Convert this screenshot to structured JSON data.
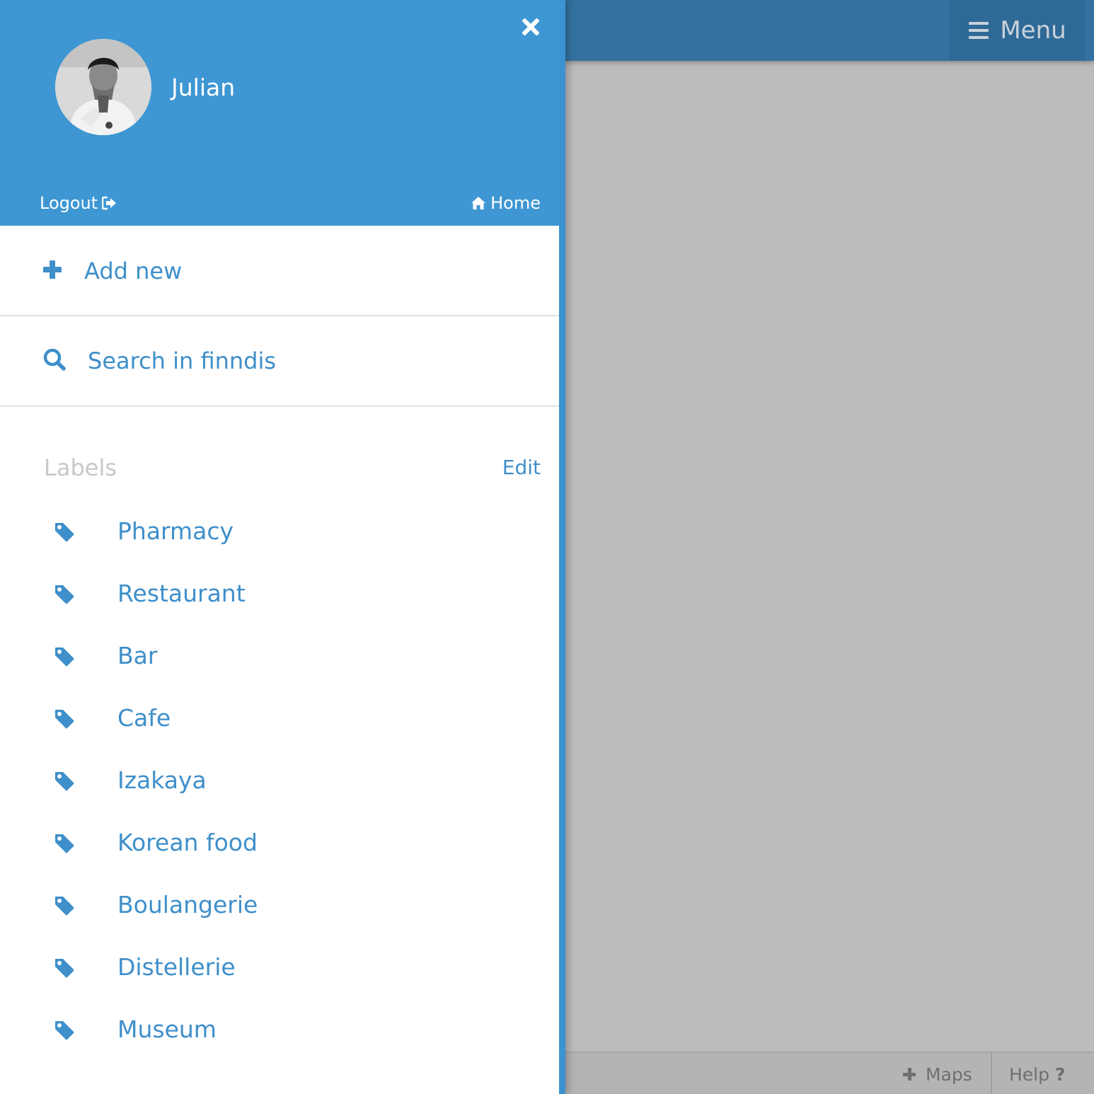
{
  "topbar": {
    "menu_label": "Menu",
    "menu_icon": "bars-icon"
  },
  "bottombar": {
    "maps_label": "Maps",
    "maps_icon": "plus-icon",
    "help_label": "Help",
    "help_icon": "question-icon"
  },
  "drawer": {
    "user": {
      "name": "Julian",
      "avatar": "user-avatar-photo"
    },
    "logout_label": "Logout",
    "logout_icon": "sign-out-icon",
    "home_label": "Home",
    "home_icon": "home-icon",
    "close_icon": "close-icon",
    "add_new_label": "Add new",
    "add_new_icon": "plus-icon",
    "search_label": "Search in finndis",
    "search_icon": "search-icon",
    "labels_heading": "Labels",
    "labels_edit": "Edit",
    "label_icon": "tag-icon",
    "labels": [
      "Pharmacy",
      "Restaurant",
      "Bar",
      "Cafe",
      "Izakaya",
      "Korean food",
      "Boulangerie",
      "Distellerie",
      "Museum"
    ]
  },
  "colors": {
    "header_blue": "#3e97d3",
    "accent_blue": "#3e8fca",
    "topbar_blue": "#3572a1",
    "overlay_gray": "#bcbcbc",
    "muted_text": "#c8c8c8"
  }
}
